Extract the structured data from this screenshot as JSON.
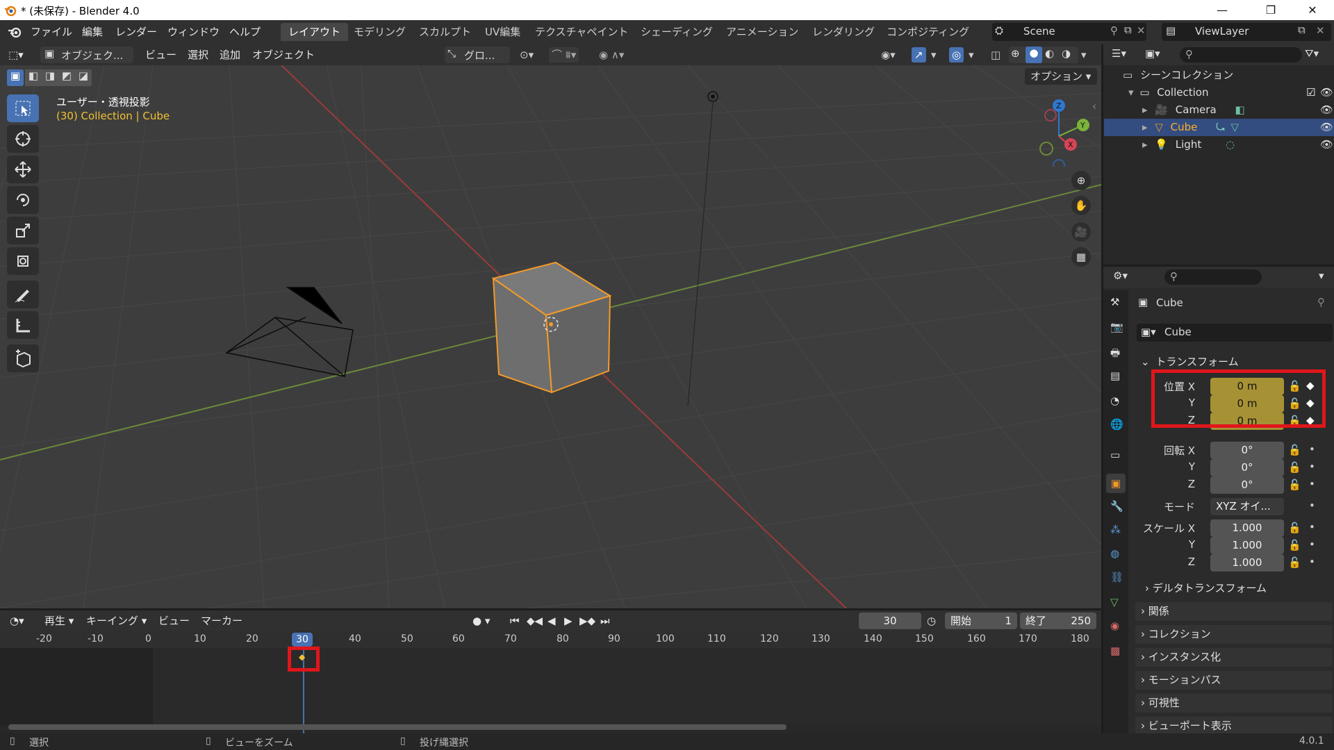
{
  "window": {
    "title": "* (未保存) - Blender 4.0",
    "controls": {
      "minimize": "—",
      "maximize": "❐",
      "close": "✕"
    }
  },
  "menu": [
    "ファイル",
    "編集",
    "レンダー",
    "ウィンドウ",
    "ヘルプ"
  ],
  "workspaces": [
    "レイアウト",
    "モデリング",
    "スカルプト",
    "UV編集",
    "テクスチャペイント",
    "シェーディング",
    "アニメーション",
    "レンダリング",
    "コンポジティング"
  ],
  "scene": {
    "name": "Scene",
    "view_layer": "ViewLayer"
  },
  "viewport_header": {
    "mode": "オブジェク...",
    "menus": [
      "ビュー",
      "選択",
      "追加",
      "オブジェクト"
    ],
    "transform_orientation": "グロ...",
    "options": "オプション"
  },
  "viewport": {
    "view_name": "ユーザー・透視投影",
    "collection_info": "(30) Collection | Cube",
    "gizmo": {
      "z": "Z",
      "y": "Y",
      "x": "X"
    }
  },
  "outliner": {
    "root": "シーンコレクション",
    "collection": "Collection",
    "items": [
      {
        "name": "Camera",
        "selected": false
      },
      {
        "name": "Cube",
        "selected": true
      },
      {
        "name": "Light",
        "selected": false
      }
    ]
  },
  "properties": {
    "object_name": "Cube",
    "datablock": "Cube",
    "transform_label": "トランスフォーム",
    "location": {
      "label": "位置 X",
      "x": "0 m",
      "y": "0 m",
      "z": "0 m"
    },
    "rotation": {
      "label": "回転 X",
      "x": "0°",
      "y": "0°",
      "z": "0°"
    },
    "mode": {
      "label": "モード",
      "value": "XYZ オイ..."
    },
    "scale": {
      "label": "スケール X",
      "x": "1.000",
      "y": "1.000",
      "z": "1.000"
    },
    "axis_y": "Y",
    "axis_z": "Z",
    "panels": [
      "デルタトランスフォーム",
      "関係",
      "コレクション",
      "インスタンス化",
      "モーションパス",
      "可視性",
      "ビューポート表示"
    ]
  },
  "timeline": {
    "menus": [
      "再生",
      "キーイング",
      "ビュー",
      "マーカー"
    ],
    "current_frame": "30",
    "start_label": "開始",
    "start": "1",
    "end_label": "終了",
    "end": "250",
    "ruler": [
      "-20",
      "-10",
      "0",
      "10",
      "20",
      "30",
      "40",
      "50",
      "60",
      "70",
      "80",
      "90",
      "100",
      "110",
      "120",
      "130",
      "140",
      "150",
      "160",
      "170",
      "180"
    ]
  },
  "statusbar": {
    "items": [
      "選択",
      "ビューをズーム",
      "投げ縄選択"
    ],
    "version": "4.0.1"
  },
  "colors": {
    "accent": "#4772b3",
    "selection_orange": "#f39a29",
    "keyed_field": "#a69235",
    "highlight_red": "#e0161b"
  }
}
